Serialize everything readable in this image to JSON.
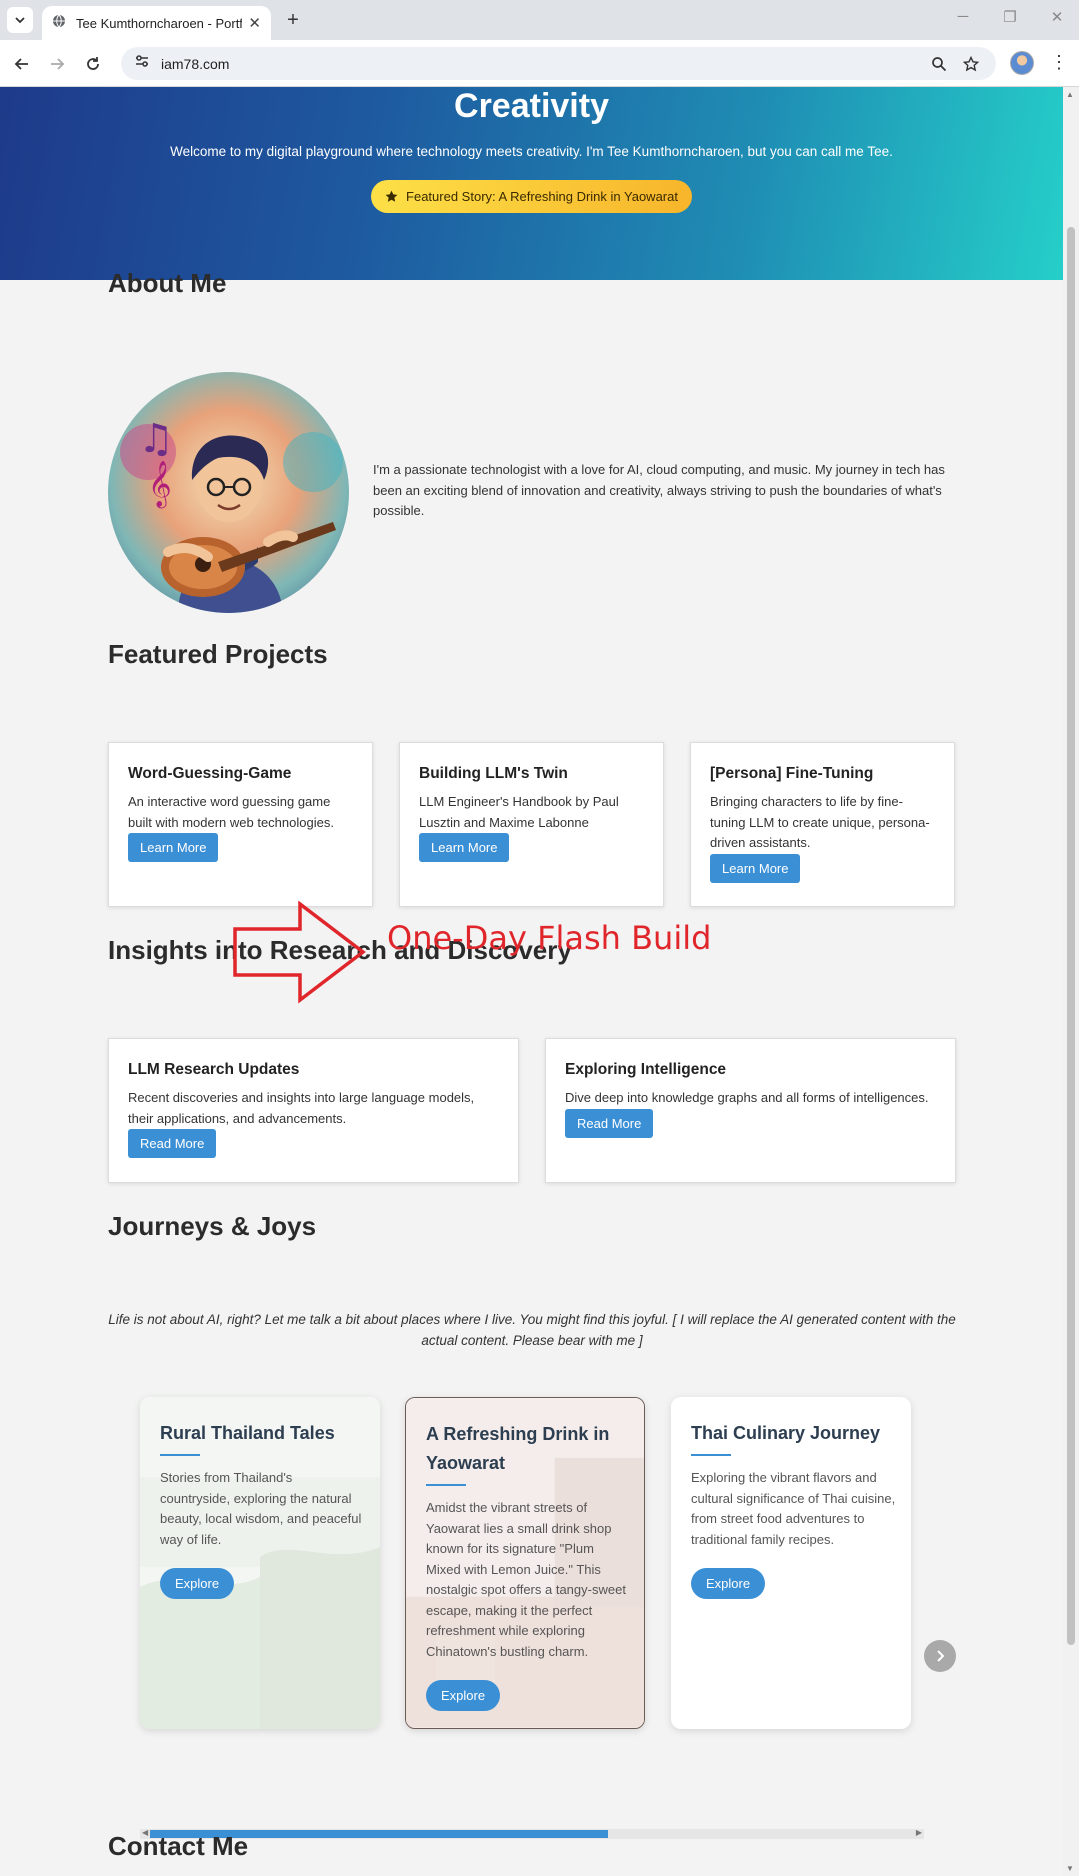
{
  "browser": {
    "tab_title": "Tee Kumthorncharoen - Portfolio",
    "url": "iam78.com",
    "icons": {
      "tab_search": "chevron-down-icon",
      "favicon": "globe-icon",
      "back": "arrow-left-icon",
      "forward": "arrow-right-icon",
      "reload": "reload-icon",
      "site_info": "tune-icon",
      "zoom": "magnifier-icon",
      "bookmark": "star-icon"
    }
  },
  "hero": {
    "title": "Creativity",
    "subtitle": "Welcome to my digital playground where technology meets creativity. I'm Tee Kumthorncharoen, but you can call me Tee.",
    "featured_button": "Featured Story: A Refreshing Drink in Yaowarat",
    "colors": {
      "gradient_start": "#1e3a8a",
      "gradient_end": "#25cfc9",
      "button": "#fde047"
    }
  },
  "about": {
    "title": "About Me",
    "text": "I'm a passionate technologist with a love for AI, cloud computing, and music. My journey in tech has been an exciting blend of innovation and creativity, always striving to push the boundaries of what's possible."
  },
  "projects": {
    "title": "Featured Projects",
    "items": [
      {
        "title": "Word-Guessing-Game",
        "desc": "An interactive word guessing game built with modern web technologies.",
        "button": "Learn More"
      },
      {
        "title": "Building LLM's Twin",
        "desc": "LLM Engineer's Handbook by Paul Lusztin and Maxime Labonne",
        "button": "Learn More"
      },
      {
        "title": "[Persona] Fine-Tuning",
        "desc": "Bringing characters to life by fine-tuning LLM to create unique, persona-driven assistants.",
        "button": "Learn More"
      }
    ]
  },
  "annotation": {
    "text": "One-Day Flash Build",
    "color": "#e0262b"
  },
  "insights": {
    "title": "Insights into Research and Discovery",
    "items": [
      {
        "title": "LLM Research Updates",
        "desc": "Recent discoveries and insights into large language models, their applications, and advancements.",
        "button": "Read More"
      },
      {
        "title": "Exploring Intelligence",
        "desc": "Dive deep into knowledge graphs and all forms of intelligences.",
        "button": "Read More"
      }
    ]
  },
  "journeys": {
    "title": "Journeys & Joys",
    "intro": "Life is not about AI, right? Let me talk a bit about places where I live. You might find this joyful. [ I will replace the AI generated content with the actual content. Please bear with me ]",
    "cards": [
      {
        "title": "Rural Thailand Tales",
        "desc": "Stories from Thailand's countryside, exploring the natural beauty, local wisdom, and peaceful way of life.",
        "button": "Explore"
      },
      {
        "title": "A Refreshing Drink in Yaowarat",
        "desc": "Amidst the vibrant streets of Yaowarat lies a small drink shop known for its signature \"Plum Mixed with Lemon Juice.\" This nostalgic spot offers a tangy-sweet escape, making it the perfect refreshment while exploring Chinatown's bustling charm.",
        "button": "Explore"
      },
      {
        "title": "Thai Culinary Journey",
        "desc": "Exploring the vibrant flavors and cultural significance of Thai cuisine, from street food adventures to traditional family recipes.",
        "button": "Explore"
      }
    ],
    "carousel_progress": 0.6
  },
  "contact": {
    "title": "Contact Me"
  },
  "accent_color": "#3b8fd5"
}
